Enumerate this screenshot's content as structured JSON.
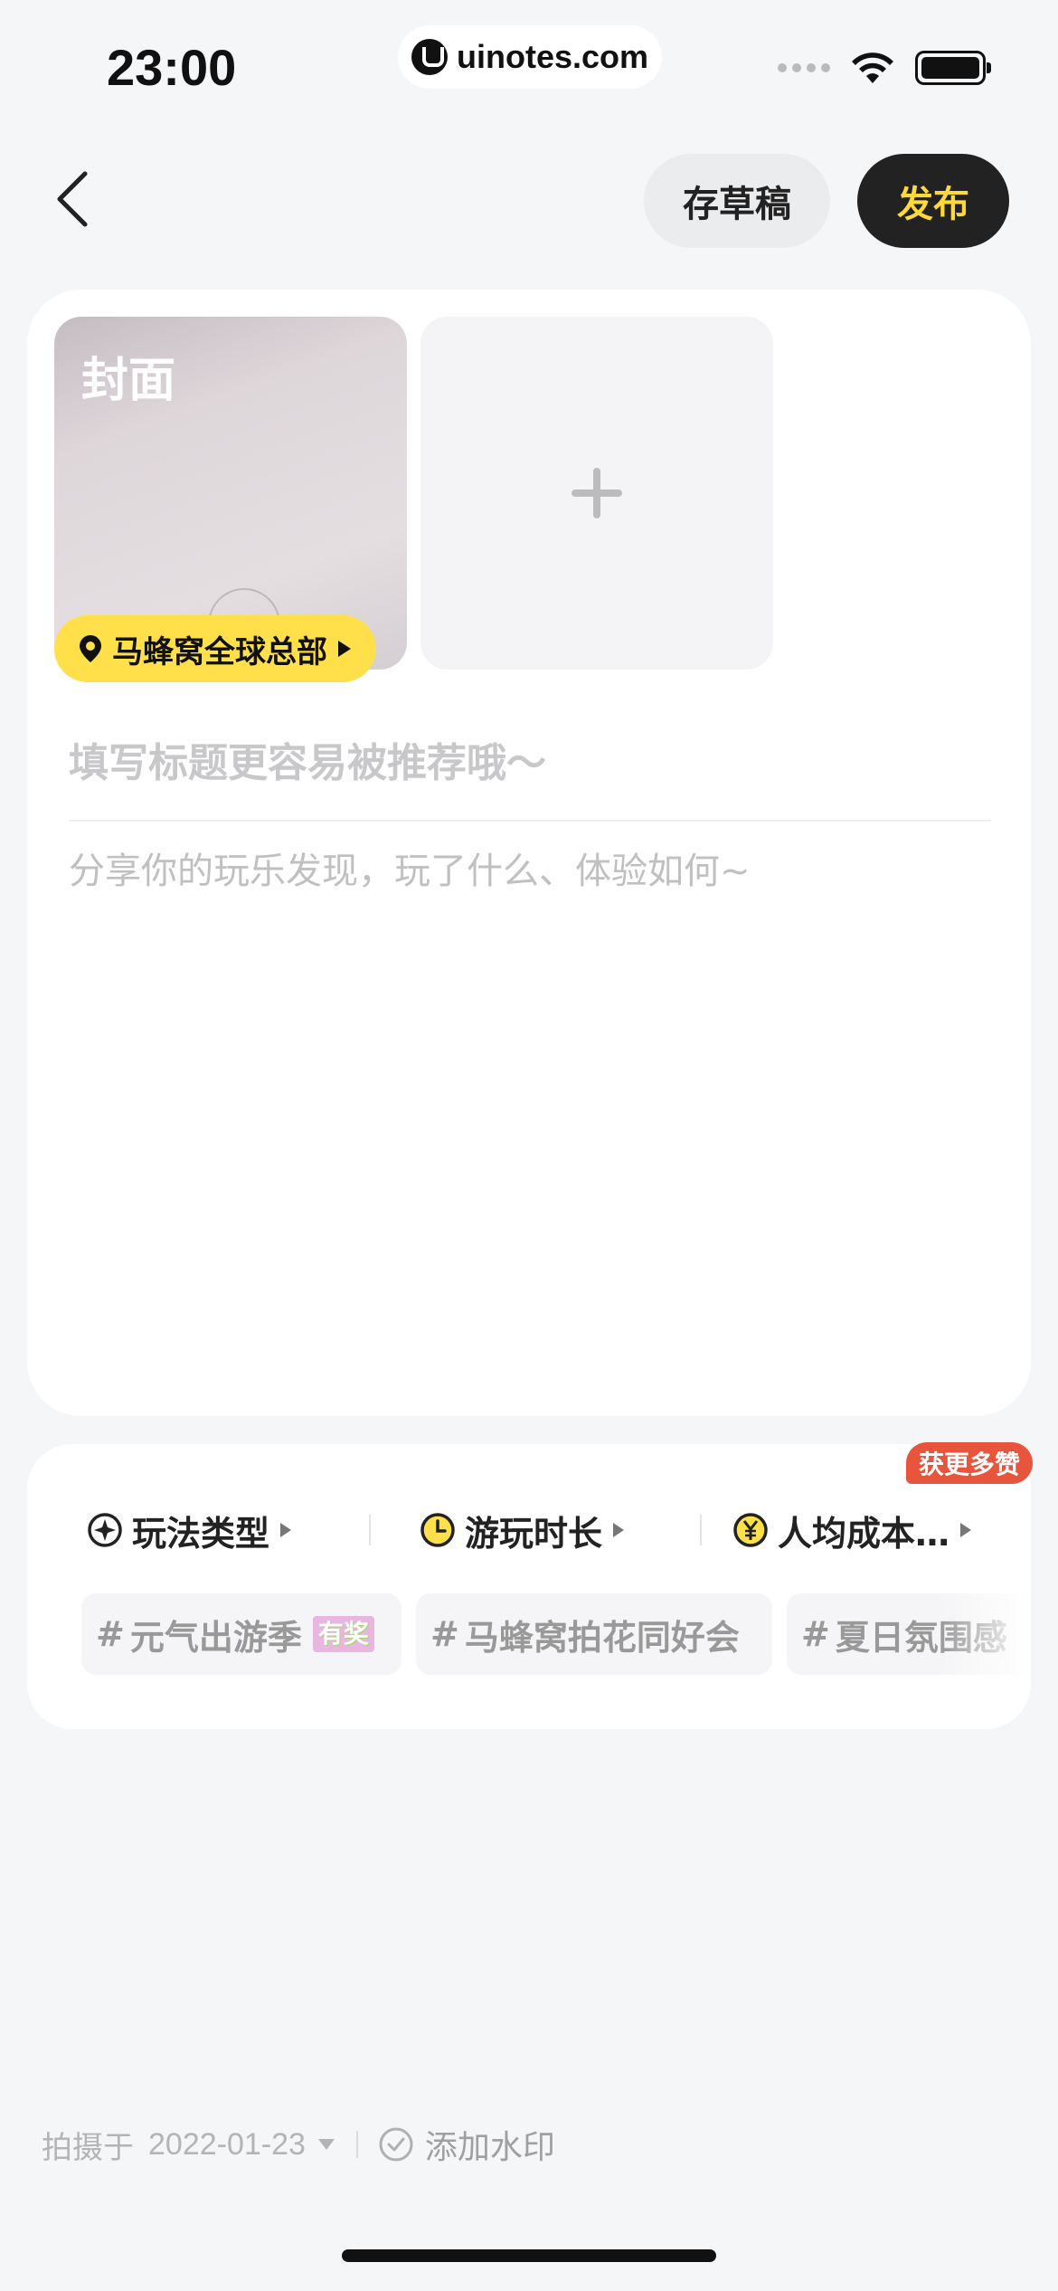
{
  "status_bar": {
    "time": "23:00",
    "url": "uinotes.com"
  },
  "nav": {
    "back_icon": "chevron-left-icon",
    "draft_label": "存草稿",
    "publish_label": "发布",
    "publish_text_color": "#ffd83a"
  },
  "editor": {
    "cover_label": "封面",
    "location_label": "马蜂窝全球总部",
    "add_photo_icon": "plus-icon",
    "title_placeholder": "填写标题更容易被推荐哦～",
    "body_placeholder": "分享你的玩乐发现，玩了什么、体验如何~"
  },
  "options": {
    "reward_badge": "获更多赞",
    "items": [
      {
        "label": "玩法类型",
        "icon": "compass-icon"
      },
      {
        "label": "游玩时长",
        "icon": "clock-icon"
      },
      {
        "label": "人均成本…",
        "icon": "yuan-icon"
      }
    ],
    "topics": [
      {
        "label": "元气出游季",
        "badge": "有奖"
      },
      {
        "label": "马蜂窝拍花同好会"
      },
      {
        "label": "夏日氛围感"
      }
    ]
  },
  "footer": {
    "shot_prefix": "拍摄于",
    "shot_date": "2022-01-23",
    "watermark_label": "添加水印"
  },
  "colors": {
    "accent_yellow": "#ffe04a",
    "reward_red": "#e8553c",
    "background": "#f5f6f8"
  }
}
